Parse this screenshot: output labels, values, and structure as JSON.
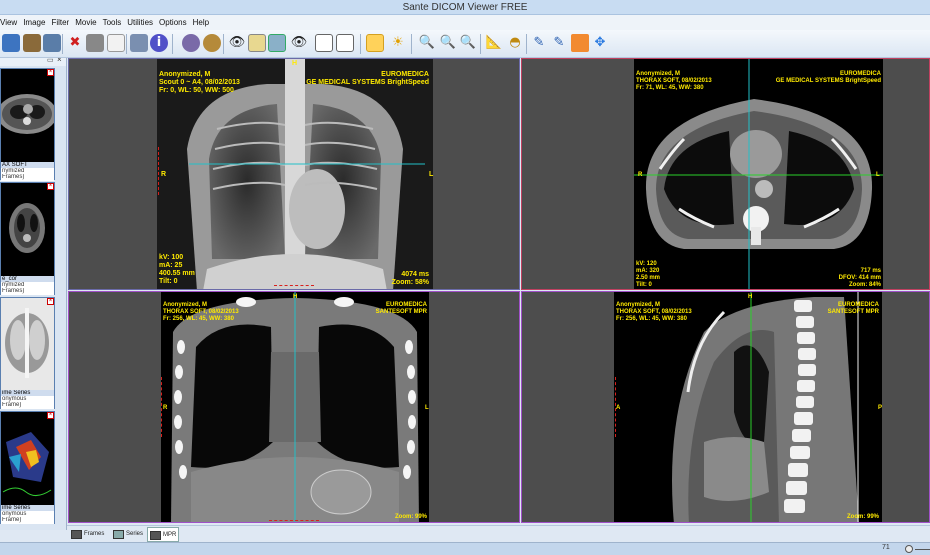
{
  "window": {
    "title": "Sante DICOM Viewer FREE"
  },
  "menu": [
    "View",
    "Image",
    "Filter",
    "Movie",
    "Tools",
    "Utilities",
    "Options",
    "Help"
  ],
  "thumbnails": [
    {
      "caption1": "AX SOFT",
      "caption2": "nymized",
      "caption3": "Frames)"
    },
    {
      "caption1": "e_cor",
      "caption2": "nymized",
      "caption3": "Frames)"
    },
    {
      "caption1": "ime Series",
      "caption2": "onymous",
      "caption3": "Frame)"
    },
    {
      "caption1": "ime Series",
      "caption2": "onymous",
      "caption3": "Frame)"
    }
  ],
  "viewports": {
    "vp1": {
      "tl": [
        "Anonymized, M",
        "Scout  0 ~ A4, 08/02/2013",
        "Fr: 0, WL: 50, WW: 500"
      ],
      "tr": [
        "EUROMEDICA",
        "GE MEDICAL SYSTEMS BrightSpeed"
      ],
      "bl": [
        "kV: 100",
        "mA: 25",
        "400.55 mm",
        "Tilt: 0"
      ],
      "br": [
        "4074 ms",
        "Zoom: 58%"
      ],
      "top": "H",
      "left": "R",
      "right": "L"
    },
    "vp2": {
      "tl": [
        "Anonymized, M",
        "THORAX SOFT, 08/02/2013",
        "Fr: 71, WL: 45, WW: 380"
      ],
      "tr": [
        "EUROMEDICA",
        "GE MEDICAL SYSTEMS BrightSpeed"
      ],
      "bl": [
        "kV: 120",
        "mA: 320",
        "2.50 mm",
        "Tilt: 0"
      ],
      "br": [
        "717 ms",
        "DFOV: 414 mm",
        "Zoom: 84%"
      ],
      "left": "R",
      "right": "L"
    },
    "vp3": {
      "tl": [
        "Anonymized, M",
        "THORAX SOFT, 08/02/2013",
        "Fr: 256, WL: 45, WW: 380"
      ],
      "tr": [
        "EUROMEDICA",
        "SANTESOFT MPR"
      ],
      "br": [
        "Zoom: 99%"
      ],
      "top": "H",
      "left": "R",
      "right": "L"
    },
    "vp4": {
      "tl": [
        "Anonymized, M",
        "THORAX SOFT, 08/02/2013",
        "Fr: 256, WL: 45, WW: 380"
      ],
      "tr": [
        "EUROMEDICA",
        "SANTESOFT MPR"
      ],
      "br": [
        "Zoom: 99%"
      ],
      "top": "H",
      "left": "A",
      "right": "P"
    }
  },
  "bottom_tabs": [
    "Frames",
    "Series",
    "MPR"
  ],
  "status": {
    "frame": "71"
  }
}
